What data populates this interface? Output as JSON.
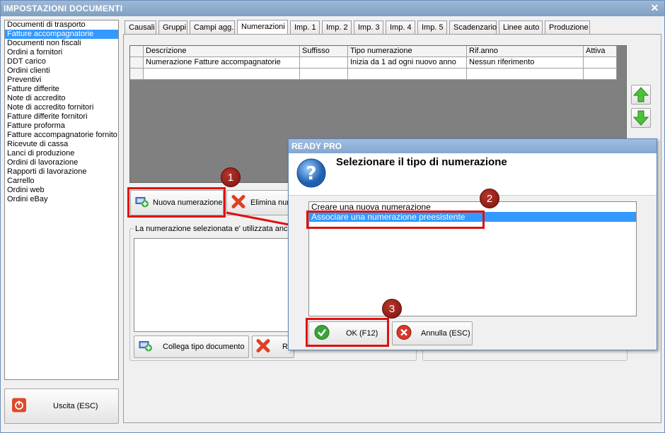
{
  "window": {
    "title": "IMPOSTAZIONI DOCUMENTI",
    "close_glyph": "✕"
  },
  "sidebar": {
    "items": [
      "Documenti di trasporto",
      "Fatture accompagnatorie",
      "Documenti non fiscali",
      "Ordini a fornitori",
      "DDT carico",
      "Ordini clienti",
      "Preventivi",
      "Fatture differite",
      "Note di accredito",
      "Note di accredito fornitori",
      "Fatture differite fornitori",
      "Fatture proforma",
      "Fatture accompagnatorie fornito",
      "Ricevute di cassa",
      "Lanci di produzione",
      "Ordini di lavorazione",
      "Rapporti di lavorazione",
      "Carrello",
      "Ordini web",
      "Ordini eBay"
    ],
    "selected_index": 1
  },
  "exit_button": {
    "label": "Uscita (ESC)",
    "icon": "power-icon"
  },
  "tabs": [
    "Causali",
    "Gruppi",
    "Campi agg.",
    "Numerazioni",
    "Imp. 1",
    "Imp. 2",
    "Imp. 3",
    "Imp. 4",
    "Imp. 5",
    "Scadenzario",
    "Linee auto",
    "Produzione"
  ],
  "active_tab": "Numerazioni",
  "grid": {
    "columns": [
      "Descrizione",
      "Suffisso",
      "Tipo numerazione",
      "Rif.anno",
      "Attiva"
    ],
    "rows": [
      [
        "Numerazione Fatture accompagnatorie",
        "",
        "Inizia da 1 ad ogni nuovo anno",
        "Nessun riferimento",
        ""
      ]
    ]
  },
  "toolbar": {
    "new_label": "Nuova numerazione",
    "delete_label": "Elimina num",
    "used_text": "La numerazione selezionata e' utilizzata anche",
    "link_label": "Collega tipo documento",
    "remove_label": "Ri"
  },
  "dialog": {
    "title": "READY PRO",
    "heading": "Selezionare il tipo di numerazione",
    "options": [
      "Creare una nuova numerazione",
      "Associare una numerazione preesistente"
    ],
    "selected_index": 1,
    "ok_label": "OK (F12)",
    "cancel_label": "Annulla (ESC)"
  },
  "annotations": [
    "1",
    "2",
    "3"
  ],
  "colors": {
    "selection": "#3399ff",
    "annotation": "#e01010",
    "title_bar": "#8fadd0"
  }
}
